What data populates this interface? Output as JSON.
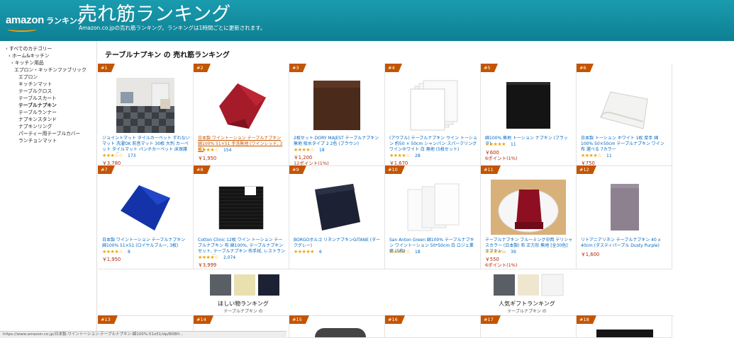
{
  "header": {
    "logo_amazon": "amazon",
    "logo_ranking": "ランキング",
    "title": "売れ筋ランキング",
    "subtitle": "Amazon.co.jpの売れ筋ランキング。ランキングは1時間ごとに更新されます。",
    "colors": {
      "bg": "#128a9c",
      "smile": "#ff9900"
    }
  },
  "sidebar": {
    "items": [
      {
        "label": "‹ すべてのカテゴリー"
      },
      {
        "label": "‹ ホーム&キッチン"
      },
      {
        "label": "‹ キッチン用品"
      },
      {
        "label": "エプロン・キッチンファブリック"
      },
      {
        "label": "エプロン"
      },
      {
        "label": "キッチンマット"
      },
      {
        "label": "テーブルクロス"
      },
      {
        "label": "テーブルスカート"
      },
      {
        "label": "テーブルナプキン"
      },
      {
        "label": "テーブルランナー"
      },
      {
        "label": "ナプキンスタンド"
      },
      {
        "label": "ナプキンリング"
      },
      {
        "label": "パーティー用テーブルカバー"
      },
      {
        "label": "ランチョンマット"
      }
    ]
  },
  "main": {
    "title": "テーブルナプキン の 売れ筋ランキング"
  },
  "products": [
    {
      "rank": "#1",
      "name": "ジョイントマット タイルカーペット ずれないマット 洗濯OK 防音マット 30枚 大判 カーペット タイルマット パンチカーペット 床保護マット 防…",
      "stars": "★★★☆☆",
      "reviews": "173",
      "price": "￥3,780",
      "points": ""
    },
    {
      "rank": "#2",
      "name": "日本製 ワイントーション テーブルナプキン 綿100% 51×51 手洗無地 (ワインレッド, 3枚)",
      "stars": "★★★★☆",
      "reviews": "154",
      "price": "￥1,950",
      "points": ""
    },
    {
      "rank": "#3",
      "name": "2枚セット DORY MAJEST テーブルナプキン 無地 吸水タイプ 2 2色 (ブラウン)",
      "stars": "★★★★☆",
      "reviews": "18",
      "price": "￥1,200",
      "points": "12ポイント(1%)"
    },
    {
      "rank": "#4",
      "name": "(アウブル) テーブルナプキン ウイン トーション 約50 × 50cm シャンパン スパークリングワインホワイト 白 無地 (5枚セット)",
      "stars": "★★★★☆",
      "reviews": "28",
      "price": "￥1,670",
      "points": ""
    },
    {
      "rank": "#5",
      "name": "綿100% 無地 トーション ナプキン (ブラック)",
      "stars": "★★★★★",
      "reviews": "11",
      "price": "￥600",
      "points": "6ポイント(1%)"
    },
    {
      "rank": "#6",
      "name": "日本製 トーション ホワイト 1枚 厚手 綿100% 50×50cm テーブルナプキン ワイン 布 選べる 7カラー",
      "stars": "★★★★☆",
      "reviews": "11",
      "price": "￥750",
      "points": ""
    },
    {
      "rank": "#7",
      "name": "日本製 ワイントーション テーブルナプキン 綿100% 51×51 (ロイヤルブルー, 3枚)",
      "stars": "★★★★☆",
      "reviews": "8",
      "price": "￥1,950",
      "points": ""
    },
    {
      "rank": "#8",
      "name": "Cotton Clinic 12枚 ワイン トーション テーブルナプキン 布 綿100%, テーブルナプキンセット, テーブルナプキン 布手拭, レストラン ホテル 業務用…",
      "stars": "★★★★☆",
      "reviews": "2,074",
      "price": "￥3,999",
      "points": ""
    },
    {
      "rank": "#9",
      "name": "BORGOボルゴ リネンナプキンGITANE (ダークグレー)",
      "stars": "★★★★★",
      "reviews": "6",
      "price": "",
      "points": ""
    },
    {
      "rank": "#10",
      "name": "San Anton Green 綿100% テーブルナプキン ワイントーション 50*50cm 白 ロジェ業務 (5枚)",
      "stars": "★★★★☆",
      "reviews": "18",
      "price": "",
      "points": ""
    },
    {
      "rank": "#11",
      "name": "テーブルナプキン ブルーミング中西 デリシャスカラー (日本製) 布 正方形 無地 [全30色] ナフキン…",
      "stars": "★★★★☆",
      "reviews": "39",
      "price": "￥550",
      "points": "6ポイント(1%)"
    },
    {
      "rank": "#12",
      "name": "リトアニアリネン テーブルナプキン 40 x 40cm (ダスティパープル Dusty Purple)",
      "stars": "",
      "reviews": "",
      "price": "￥1,600",
      "points": ""
    },
    {
      "rank": "#13"
    },
    {
      "rank": "#14"
    },
    {
      "rank": "#15"
    },
    {
      "rank": "#16"
    },
    {
      "rank": "#17"
    },
    {
      "rank": "#18"
    }
  ],
  "promos": [
    {
      "title": "ほしい物ランキング",
      "sub": "テーブルナプキン の"
    },
    {
      "title": "人気ギフトランキング",
      "sub": "テーブルナプキン の"
    }
  ],
  "status_bar": "https://www.amazon.co.jp/日本製-ワイントーション-テーブルナプキン-綿100%-51x51/dp/B08H..."
}
